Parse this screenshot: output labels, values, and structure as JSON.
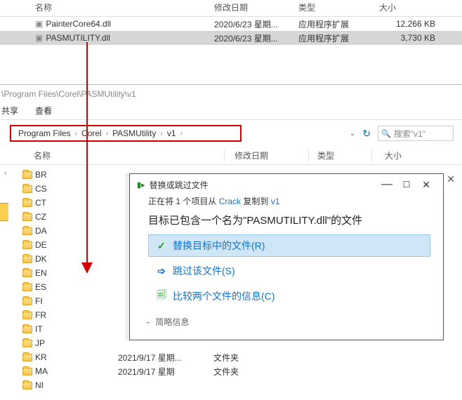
{
  "top_window": {
    "cols": {
      "name": "名称",
      "date": "修改日期",
      "type": "类型",
      "size": "大小"
    },
    "files": [
      {
        "name": "PainterCore64.dll",
        "date": "2020/6/23 星期...",
        "type": "应用程序扩展",
        "size": "12,266 KB"
      },
      {
        "name": "PASMUTILITY.dll",
        "date": "2020/6/23 星期...",
        "type": "应用程序扩展",
        "size": "3,730 KB"
      }
    ]
  },
  "bottom_window": {
    "title_path": "\\Program Files\\Corel\\PASMUtility\\v1",
    "tabs": {
      "share": "共享",
      "view": "查看"
    },
    "breadcrumbs": [
      "Program Files",
      "Corel",
      "PASMUtility",
      "v1"
    ],
    "search_placeholder": "搜索\"v1\"",
    "cols": {
      "name": "名称",
      "date": "修改日期",
      "type": "类型",
      "size": "大小"
    },
    "folders": [
      "BR",
      "CS",
      "CT",
      "CZ",
      "DA",
      "DE",
      "DK",
      "EN",
      "ES",
      "FI",
      "FR",
      "IT",
      "JP",
      "KR",
      "MA",
      "NI"
    ],
    "rows": [
      {
        "date": "2021/9/17 星期...",
        "type": "文件夹"
      },
      {
        "date": "2021/9/17 星期",
        "type": "文件夹"
      }
    ]
  },
  "dialog": {
    "title": "替换或跳过文件",
    "sub_prefix": "正在将 1 个项目从 ",
    "sub_src": "Crack",
    "sub_mid": " 复制到 ",
    "sub_dst": "v1",
    "main_text": "目标已包含一个名为\"PASMUTILITY.dll\"的文件",
    "action_replace": "替换目标中的文件(R)",
    "action_skip": "跳过该文件(S)",
    "action_compare": "比较两个文件的信息(C)",
    "more": "简略信息"
  }
}
